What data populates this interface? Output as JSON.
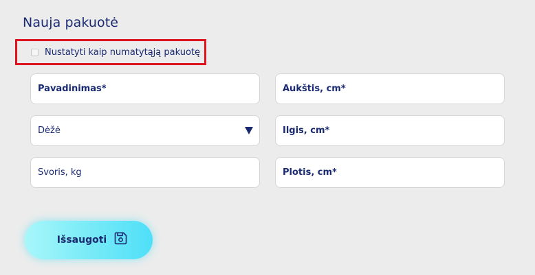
{
  "form": {
    "title": "Nauja pakuotė",
    "default_checkbox": {
      "label": "Nustatyti kaip numatytąją pakuotę",
      "checked": false
    },
    "fields": {
      "name": {
        "label": "Pavadinimas*"
      },
      "type": {
        "value": "Dėžė"
      },
      "weight": {
        "label": "Svoris, kg"
      },
      "height": {
        "label": "Aukštis, cm*"
      },
      "length": {
        "label": "Ilgis, cm*"
      },
      "width": {
        "label": "Plotis, cm*"
      }
    },
    "save_button": {
      "label": "Išsaugoti",
      "icon": "floppy-disk-icon"
    }
  },
  "colors": {
    "background": "#ececec",
    "text": "#1a2a72",
    "highlight_border": "#e0141e",
    "button_gradient_start": "#a8f7fa",
    "button_gradient_end": "#4fdff8"
  }
}
